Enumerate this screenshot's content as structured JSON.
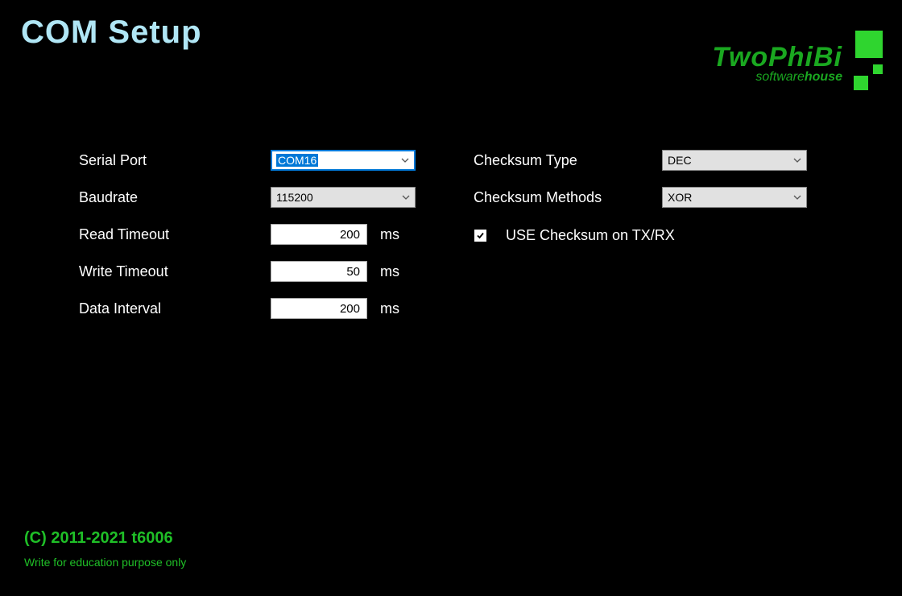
{
  "title": "COM Setup",
  "logo": {
    "brand": "TwoPhiBi",
    "sub_light": "software",
    "sub_bold": "house"
  },
  "left": {
    "serial_port": {
      "label": "Serial Port",
      "value": "COM16"
    },
    "baudrate": {
      "label": "Baudrate",
      "value": "115200"
    },
    "read_timeout": {
      "label": "Read Timeout",
      "value": "200",
      "unit": "ms"
    },
    "write_timeout": {
      "label": "Write Timeout",
      "value": "50",
      "unit": "ms"
    },
    "data_interval": {
      "label": "Data Interval",
      "value": "200",
      "unit": "ms"
    }
  },
  "right": {
    "checksum_type": {
      "label": "Checksum  Type",
      "value": "DEC"
    },
    "checksum_methods": {
      "label": "Checksum Methods",
      "value": "XOR"
    },
    "use_checksum": {
      "label": "USE Checksum on TX/RX",
      "checked": true
    }
  },
  "footer": {
    "copyright": "(C) 2011-2021 t6006",
    "disclaimer": "Write for education purpose only"
  }
}
